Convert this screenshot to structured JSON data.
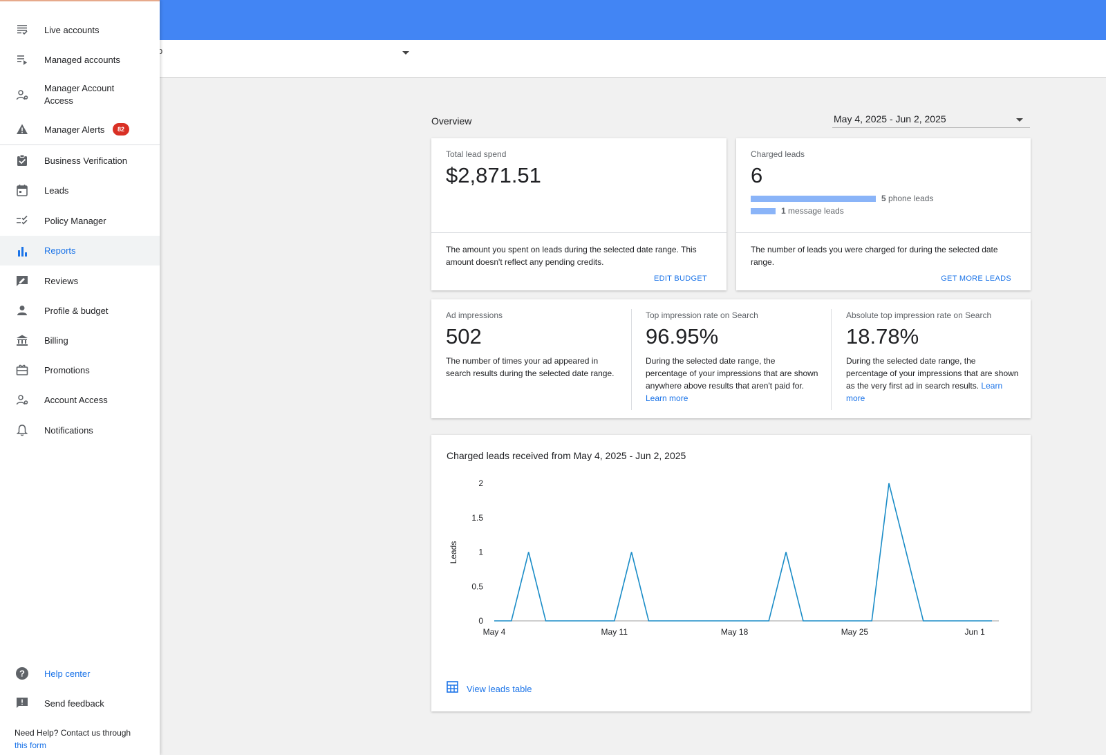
{
  "header": {
    "fragment": "p"
  },
  "sidebar": {
    "items": [
      {
        "label": "Live accounts",
        "icon": "live-accounts-icon"
      },
      {
        "label": "Managed accounts",
        "icon": "managed-accounts-icon"
      },
      {
        "label": "Manager Account Access",
        "icon": "manager-access-icon"
      },
      {
        "label": "Manager Alerts",
        "icon": "warning-icon",
        "badge": "82"
      },
      {
        "label": "Business Verification",
        "icon": "verification-icon"
      },
      {
        "label": "Leads",
        "icon": "calendar-icon"
      },
      {
        "label": "Policy Manager",
        "icon": "policy-icon"
      },
      {
        "label": "Reports",
        "icon": "bar-chart-icon",
        "active": true
      },
      {
        "label": "Reviews",
        "icon": "reviews-icon"
      },
      {
        "label": "Profile & budget",
        "icon": "person-icon"
      },
      {
        "label": "Billing",
        "icon": "bank-icon"
      },
      {
        "label": "Promotions",
        "icon": "gift-icon"
      },
      {
        "label": "Account Access",
        "icon": "account-access-icon"
      },
      {
        "label": "Notifications",
        "icon": "bell-icon"
      }
    ],
    "footer": [
      {
        "label": "Help center",
        "icon": "help-icon"
      },
      {
        "label": "Send feedback",
        "icon": "feedback-icon"
      }
    ],
    "help_text": "Need Help? Contact us through",
    "help_link": "this form"
  },
  "overview": {
    "title": "Overview",
    "date_range": "May 4, 2025 - Jun 2, 2025"
  },
  "spend_card": {
    "title": "Total lead spend",
    "value": "$2,871.51",
    "description": "The amount you spent on leads during the selected date range. This amount doesn't reflect any pending credits.",
    "action": "EDIT BUDGET"
  },
  "leads_card": {
    "title": "Charged leads",
    "value": "6",
    "phone_count": "5",
    "phone_label": "phone leads",
    "message_count": "1",
    "message_label": "message leads",
    "description": "The number of leads you were charged for during the selected date range.",
    "action": "GET MORE LEADS"
  },
  "metrics": [
    {
      "title": "Ad impressions",
      "value": "502",
      "description": "The number of times your ad appeared in search results during the selected date range.",
      "link": ""
    },
    {
      "title": "Top impression rate on Search",
      "value": "96.95%",
      "description": "During the selected date range, the percentage of your impressions that are shown anywhere above results that aren't paid for.",
      "link": "Learn more"
    },
    {
      "title": "Absolute top impression rate on Search",
      "value": "18.78%",
      "description": "During the selected date range, the percentage of your impressions that are shown as the very first ad in search results.",
      "link": "Learn more"
    }
  ],
  "chart_card": {
    "title": "Charged leads received from May 4, 2025 - Jun 2, 2025",
    "view_table": "View leads table"
  },
  "chart_data": {
    "type": "line",
    "title": "Charged leads received from May 4, 2025 - Jun 2, 2025",
    "xlabel": "",
    "ylabel": "Leads",
    "x": [
      "2025-05-04",
      "2025-05-05",
      "2025-05-06",
      "2025-05-07",
      "2025-05-08",
      "2025-05-09",
      "2025-05-10",
      "2025-05-11",
      "2025-05-12",
      "2025-05-13",
      "2025-05-14",
      "2025-05-15",
      "2025-05-16",
      "2025-05-17",
      "2025-05-18",
      "2025-05-19",
      "2025-05-20",
      "2025-05-21",
      "2025-05-22",
      "2025-05-23",
      "2025-05-24",
      "2025-05-25",
      "2025-05-26",
      "2025-05-27",
      "2025-05-28",
      "2025-05-29",
      "2025-05-30",
      "2025-05-31",
      "2025-06-01",
      "2025-06-02"
    ],
    "series": [
      {
        "values": [
          0,
          0,
          1,
          0,
          0,
          0,
          0,
          0,
          1,
          0,
          0,
          0,
          0,
          0,
          0,
          0,
          0,
          1,
          0,
          0,
          0,
          0,
          0,
          2,
          1,
          0,
          0,
          0,
          0,
          0
        ]
      }
    ],
    "ylim": [
      0,
      2
    ],
    "yticks": [
      "0",
      "0.5",
      "1",
      "1.5",
      "2"
    ],
    "xticks": [
      "May 4",
      "May 11",
      "May 18",
      "May 25",
      "Jun 1"
    ],
    "color": "#1a8cc7",
    "grid": false
  },
  "colors": {
    "header": "#4285f4",
    "accent": "#1a73e8",
    "badge": "#d93025",
    "bar": "#8ab4f8"
  }
}
